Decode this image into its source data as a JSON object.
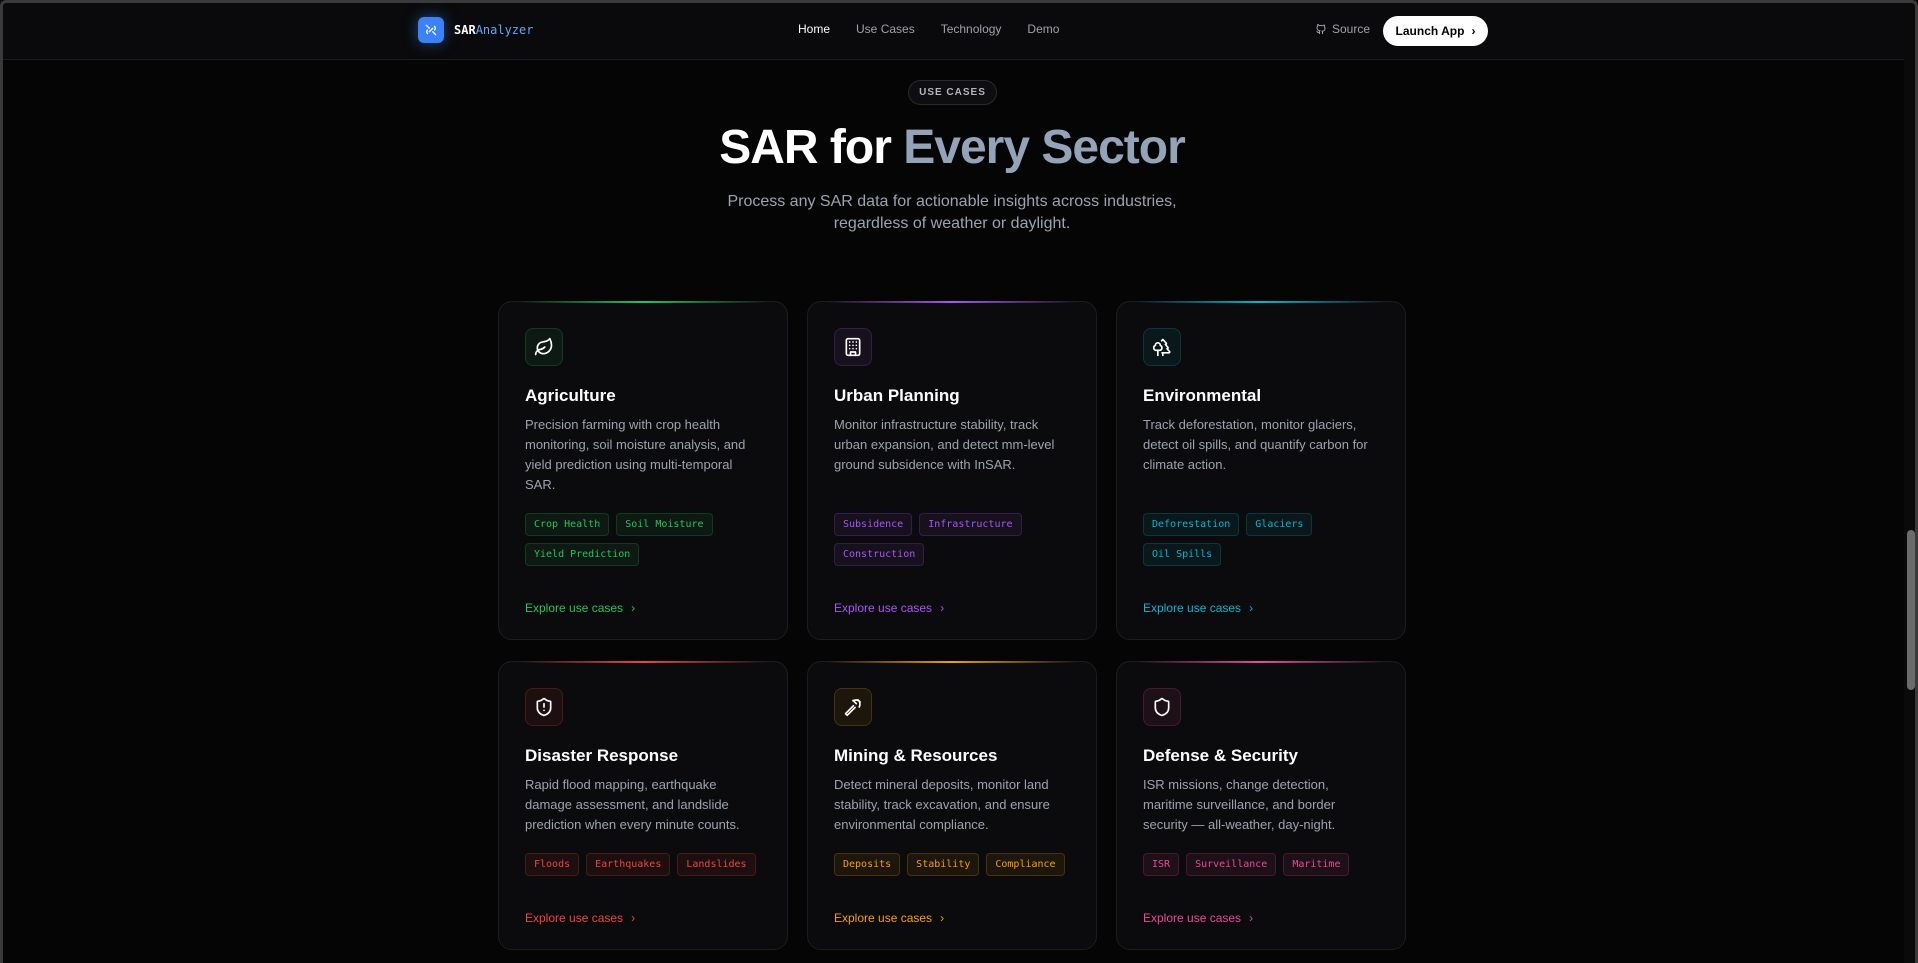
{
  "header": {
    "logo_a": "SAR",
    "logo_b": "Analyzer",
    "nav": [
      "Home",
      "Use Cases",
      "Technology",
      "Demo"
    ],
    "source": "Source",
    "launch": "Launch App"
  },
  "hero": {
    "badge": "USE CASES",
    "title_a": "SAR for ",
    "title_b": "Every Sector",
    "subtitle": "Process any SAR data for actionable insights across industries, regardless of weather or daylight."
  },
  "cards": [
    {
      "title": "Agriculture",
      "icon": "leaf-icon",
      "color": "#22c55e",
      "desc": "Precision farming with crop health monitoring, soil moisture analysis, and yield prediction using multi-temporal SAR.",
      "tags": [
        "Crop Health",
        "Soil Moisture",
        "Yield Prediction"
      ],
      "link": "Explore use cases"
    },
    {
      "title": "Urban Planning",
      "icon": "building-icon",
      "color": "#a855f7",
      "desc": "Monitor infrastructure stability, track urban expansion, and detect mm-level ground subsidence with InSAR.",
      "tags": [
        "Subsidence",
        "Infrastructure",
        "Construction"
      ],
      "link": "Explore use cases"
    },
    {
      "title": "Environmental",
      "icon": "trees-icon",
      "color": "#06b6d4",
      "desc": "Track deforestation, monitor glaciers, detect oil spills, and quantify carbon for climate action.",
      "tags": [
        "Deforestation",
        "Glaciers",
        "Oil Spills"
      ],
      "link": "Explore use cases"
    },
    {
      "title": "Disaster Response",
      "icon": "shield-alert-icon",
      "color": "#ef4444",
      "desc": "Rapid flood mapping, earthquake damage assessment, and landslide prediction when every minute counts.",
      "tags": [
        "Floods",
        "Earthquakes",
        "Landslides"
      ],
      "link": "Explore use cases"
    },
    {
      "title": "Mining & Resources",
      "icon": "pickaxe-icon",
      "color": "#f59e0b",
      "desc": "Detect mineral deposits, monitor land stability, track excavation, and ensure environmental compliance.",
      "tags": [
        "Deposits",
        "Stability",
        "Compliance"
      ],
      "link": "Explore use cases"
    },
    {
      "title": "Defense & Security",
      "icon": "shield-icon",
      "color": "#ec4899",
      "desc": "ISR missions, change detection, maritime surveillance, and border security — all-weather, day-night.",
      "tags": [
        "ISR",
        "Surveillance",
        "Maritime"
      ],
      "link": "Explore use cases"
    }
  ]
}
